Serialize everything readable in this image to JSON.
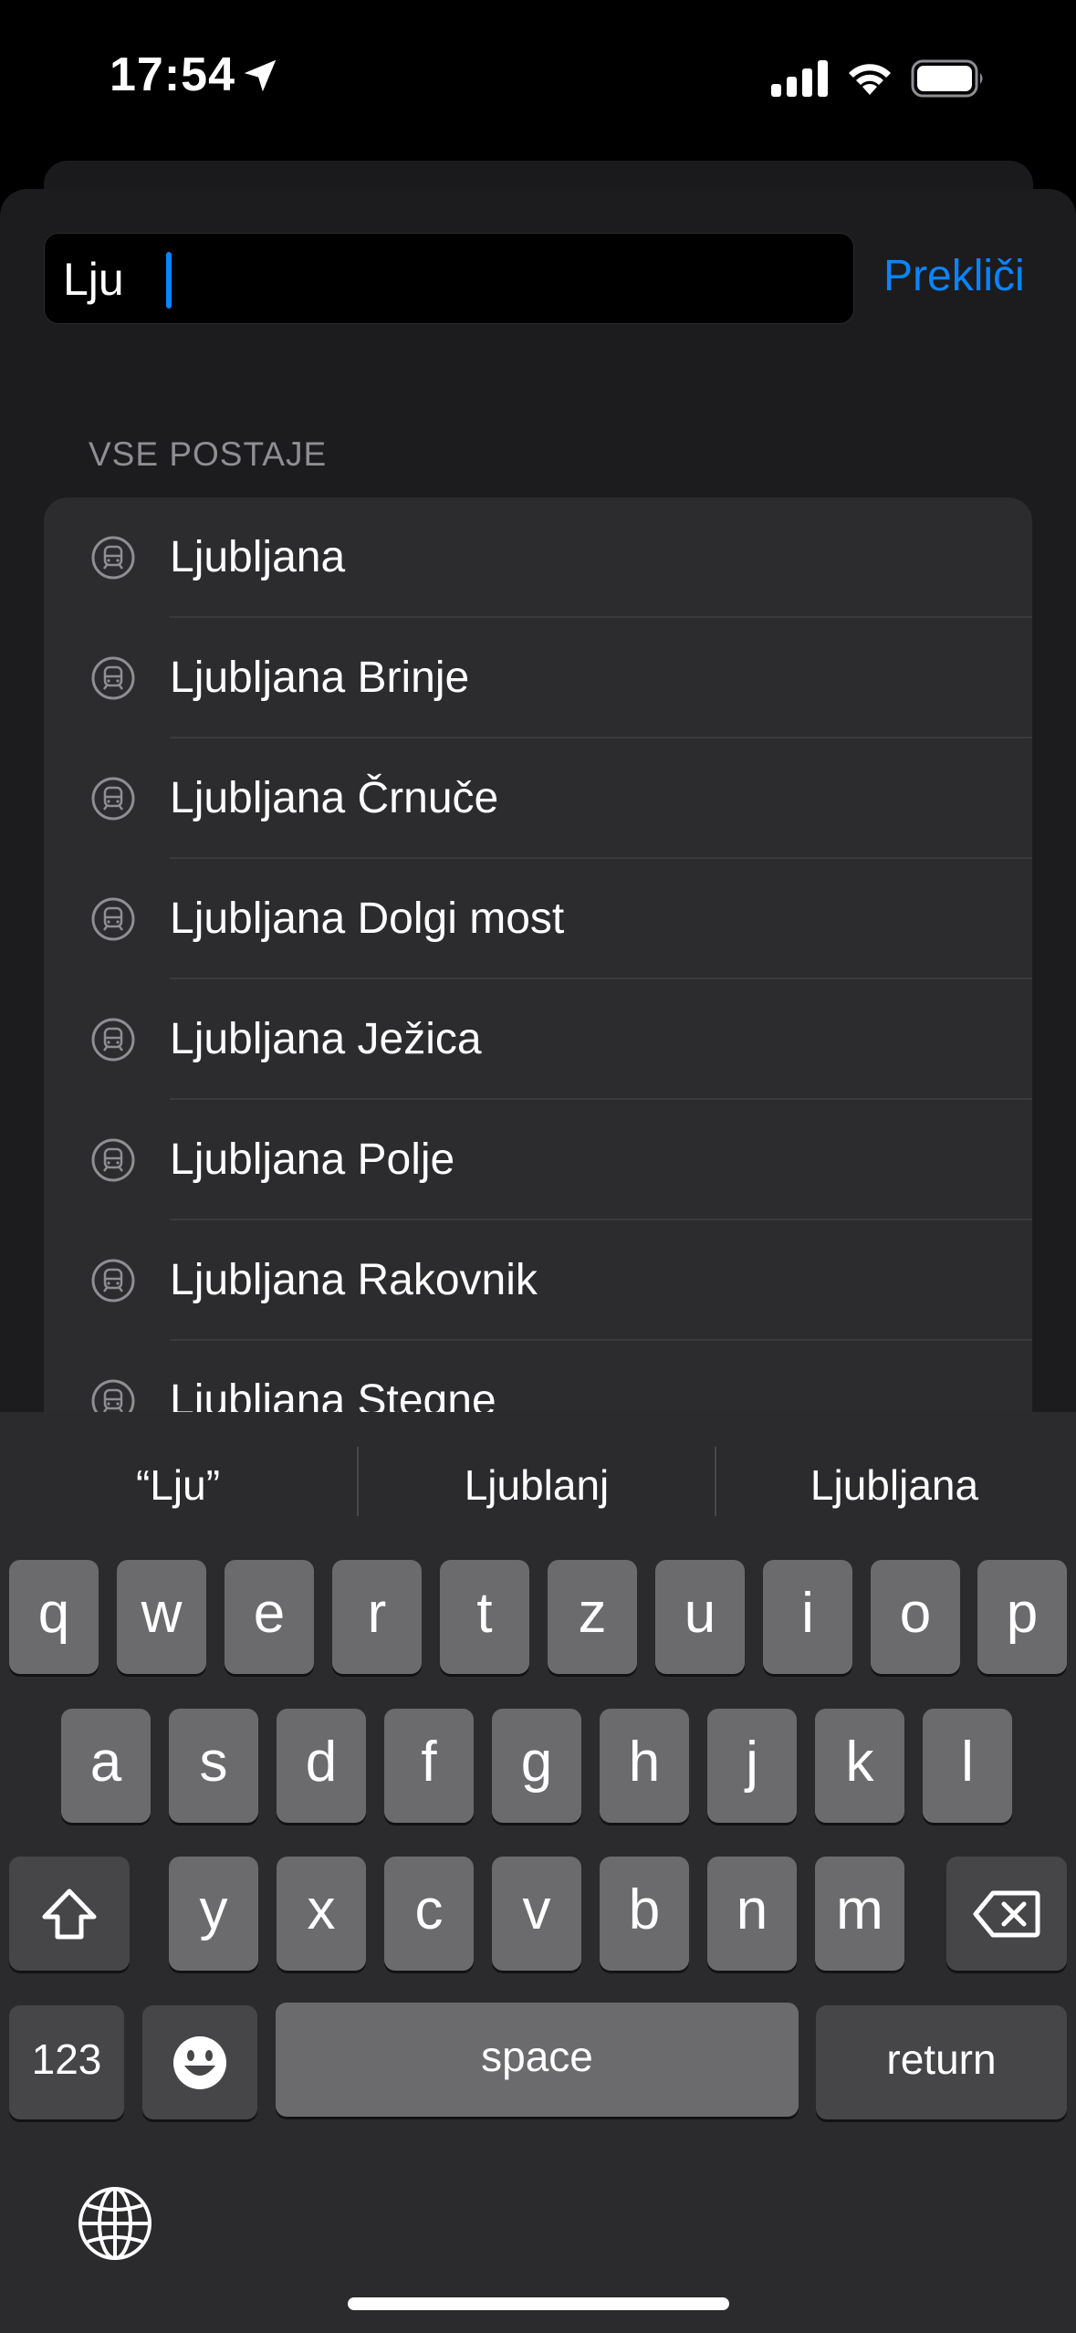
{
  "status_bar": {
    "time": "17:54"
  },
  "search": {
    "value": "Lju",
    "cancel_label": "Prekliči"
  },
  "section_header": "VSE POSTAJE",
  "stations": [
    "Ljubljana",
    "Ljubljana Brinje",
    "Ljubljana Črnuče",
    "Ljubljana Dolgi most",
    "Ljubljana Ježica",
    "Ljubljana Polje",
    "Ljubljana Rakovnik",
    "Ljubljana Stegne"
  ],
  "keyboard": {
    "suggestions": [
      "“Lju”",
      "Ljublanj",
      "Ljubljana"
    ],
    "row1": [
      "q",
      "w",
      "e",
      "r",
      "t",
      "z",
      "u",
      "i",
      "o",
      "p"
    ],
    "row2": [
      "a",
      "s",
      "d",
      "f",
      "g",
      "h",
      "j",
      "k",
      "l"
    ],
    "row3": [
      "y",
      "x",
      "c",
      "v",
      "b",
      "n",
      "m"
    ],
    "numbers_label": "123",
    "space_label": "space",
    "return_label": "return"
  },
  "colors": {
    "accent": "#0a84ff",
    "sheet": "#1c1c1e",
    "list_bg": "#2c2c2e"
  }
}
